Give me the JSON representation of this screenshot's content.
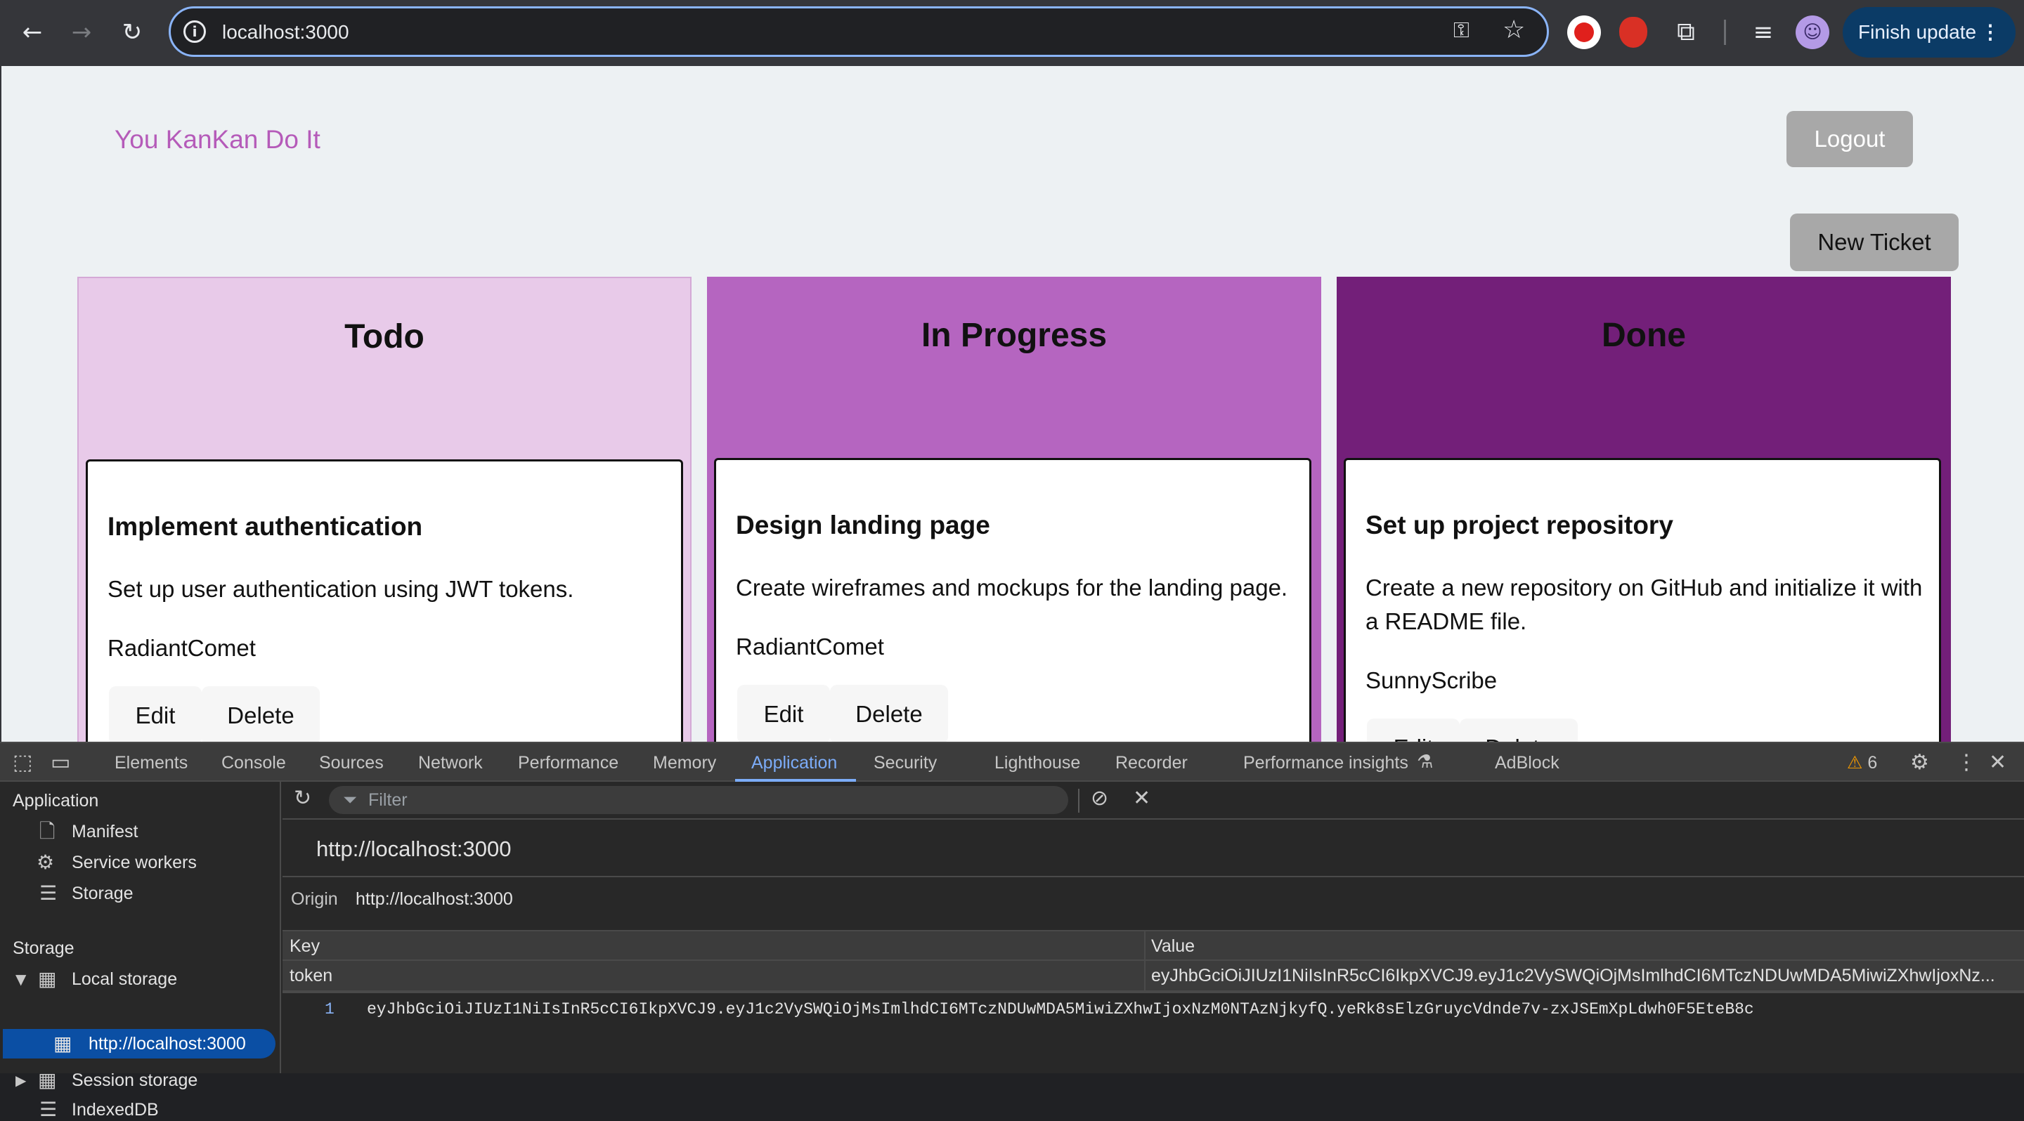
{
  "browser": {
    "url": "localhost:3000",
    "finish_update_label": "Finish update",
    "back_icon": "arrow-left-icon",
    "forward_icon": "arrow-right-icon",
    "reload_icon": "reload-icon"
  },
  "app": {
    "brand": "You KanKan Do It",
    "logout_label": "Logout",
    "new_ticket_label": "New Ticket",
    "columns": [
      {
        "title": "Todo",
        "color": "#e8cae9",
        "cards": [
          {
            "title": "Implement authentication",
            "description": "Set up user authentication using JWT tokens.",
            "user": "RadiantComet"
          }
        ]
      },
      {
        "title": "In Progress",
        "color": "#b565c0",
        "cards": [
          {
            "title": "Design landing page",
            "description": "Create wireframes and mockups for the landing page.",
            "user": "RadiantComet"
          }
        ]
      },
      {
        "title": "Done",
        "color": "#731f79",
        "cards": [
          {
            "title": "Set up project repository",
            "description": "Create a new repository on GitHub and initialize it with a README file.",
            "user": "SunnyScribe"
          }
        ]
      }
    ],
    "edit_label": "Edit",
    "delete_label": "Delete"
  },
  "devtools": {
    "tabs": [
      "Elements",
      "Console",
      "Sources",
      "Network",
      "Performance",
      "Memory",
      "Application",
      "Security",
      "Lighthouse",
      "Recorder",
      "Performance insights",
      "AdBlock"
    ],
    "active_tab": "Application",
    "warning_count": "6",
    "sidebar": {
      "application_heading": "Application",
      "application_items": [
        "Manifest",
        "Service workers",
        "Storage"
      ],
      "storage_heading": "Storage",
      "local_storage": "Local storage",
      "local_storage_origin": "http://localhost:3000",
      "session_storage": "Session storage",
      "indexeddb": "IndexedDB"
    },
    "filter_placeholder": "Filter",
    "origin_title": "http://localhost:3000",
    "origin_label": "Origin",
    "origin_value": "http://localhost:3000",
    "table": {
      "key_header": "Key",
      "value_header": "Value",
      "row_key": "token",
      "row_value": "eyJhbGciOiJIUzI1NiIsInR5cCI6IkpXVCJ9.eyJ1c2VySWQiOjMsImlhdCI6MTczNDUwMDA5MiwiZXhwIjoxNz..."
    },
    "preview_line_number": "1",
    "preview_value": "eyJhbGciOiJIUzI1NiIsInR5cCI6IkpXVCJ9.eyJ1c2VySWQiOjMsImlhdCI6MTczNDUwMDA5MiwiZXhwIjoxNzM0NTAzNjkyfQ.yeRk8sElzGruycVdnde7v-zxJSEmXpLdwh0F5EteB8c"
  }
}
